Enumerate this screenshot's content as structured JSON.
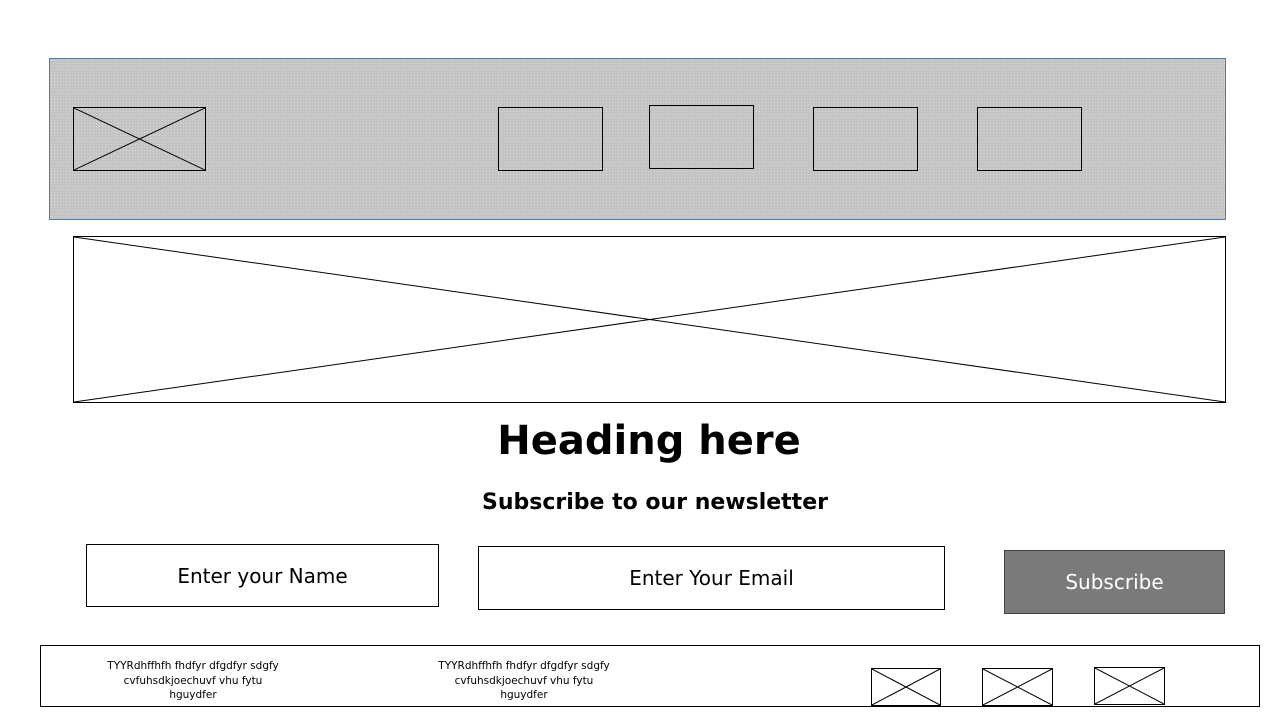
{
  "hero": {
    "heading": "Heading here",
    "subheading": "Subscribe to our newsletter"
  },
  "newsletter": {
    "name_placeholder": "Enter your Name",
    "email_placeholder": "Enter Your Email",
    "subscribe_label": "Subscribe"
  },
  "footer": {
    "columns": [
      {
        "text": "TYYRdhffhfh fhdfyr dfgdfyr sdgfy\ncvfuhsdkjoechuvf vhu fytu\nhguydfer"
      },
      {
        "text": "TYYRdhffhfh fhdfyr dfgdfyr sdgfy\ncvfuhsdkjoechuvf vhu fytu\nhguydfer"
      }
    ]
  },
  "colors": {
    "header_bg": "#c4c4c4",
    "header_border": "#4a7fb5",
    "button_bg": "#7a7a7a",
    "button_text": "#ffffff"
  }
}
